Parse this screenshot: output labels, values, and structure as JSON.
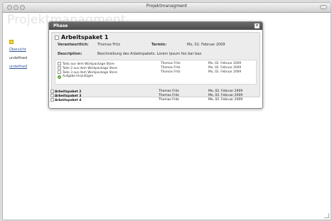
{
  "window": {
    "title": "Projektmanagment"
  },
  "brand": "Projektmanagment",
  "sidebar": {
    "items": [
      {
        "label": "Übersicht"
      },
      {
        "label": "undefined"
      },
      {
        "label": "undefined"
      }
    ]
  },
  "phase": {
    "title": "Phase",
    "package": {
      "name": "Arbeitspaket 1",
      "responsible_label": "Verantwortlich:",
      "responsible": "Thomas Fritz",
      "deadline_label": "Termin:",
      "deadline": "Mo, 02. Februar 2009",
      "description_label": "Description:",
      "description": "Beschreibung des Arbeitspakets. Lorem Ipsum foo bar baz.",
      "tasks": [
        {
          "name": "Todo aus dem Workpackage Store",
          "person": "Thomas Fritz",
          "date": "Mo, 02. Februar 2009"
        },
        {
          "name": "Todo 2 aus dem Workpackage Store",
          "person": "Thomas Fritz",
          "date": "Mo, 02. Februar 2009"
        },
        {
          "name": "Todo 3 aus dem Workpackage Store",
          "person": "Thomas Fritz",
          "date": "Mo, 02. Februar 2009"
        }
      ],
      "add_task_label": "Aufgabe hinzufügen"
    },
    "packages": [
      {
        "name": "Arbeitspaket 2",
        "person": "Thomas Fritz",
        "date": "Mo, 02. Februar 2009"
      },
      {
        "name": "Arbeitspaket 3",
        "person": "Thomas Fritz",
        "date": "Mo, 02. Februar 2009"
      },
      {
        "name": "Arbeitspaket 4",
        "person": "Thomas Fritz",
        "date": "Mo, 02. Februar 2009"
      }
    ]
  }
}
